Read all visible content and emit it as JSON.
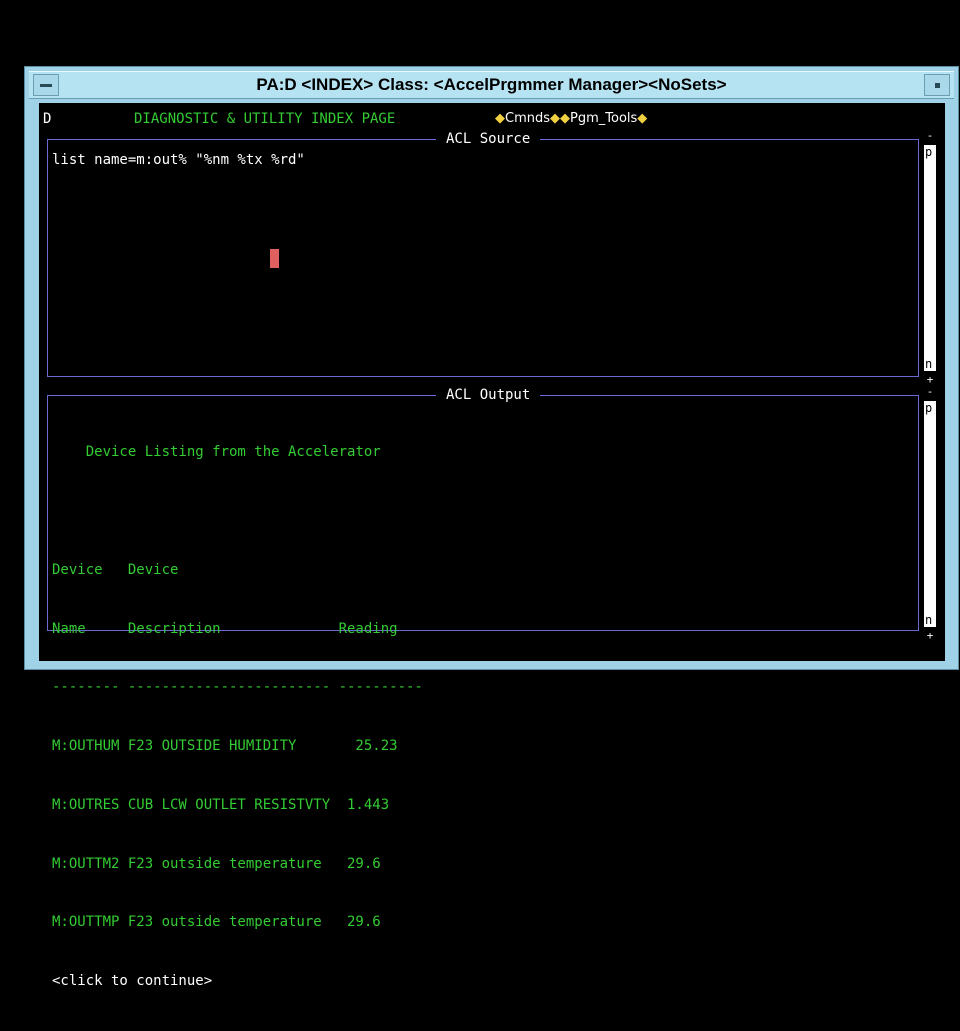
{
  "window": {
    "title": "PA:D <INDEX> Class: <AccelPrgmmer Manager><NoSets>"
  },
  "header": {
    "page_letter": "D",
    "page_heading": "DIAGNOSTIC & UTILITY INDEX PAGE",
    "menus": [
      {
        "label": "Cmnds"
      },
      {
        "label": "Pgm_Tools"
      }
    ]
  },
  "source_panel": {
    "label": "ACL Source",
    "text": "list name=m:out% \"%nm %tx %rd\""
  },
  "output_panel": {
    "label": "ACL Output",
    "title": "Device Listing from the Accelerator",
    "header_line1": "Device   Device",
    "header_line2": "Name     Description              Reading",
    "separator": "-------- ------------------------ ----------",
    "rows": [
      "M:OUTHUM F23 OUTSIDE HUMIDITY       25.23",
      "M:OUTRES CUB LCW OUTLET RESISTVTY  1.443",
      "M:OUTTM2 F23 outside temperature   29.6",
      "M:OUTTMP F23 outside temperature   29.6"
    ],
    "continue_prompt": "<click to continue>"
  },
  "scrollbar": {
    "top_glyph": "-",
    "bottom_glyph": "+",
    "page_up": "p",
    "page_down": "n"
  },
  "colors": {
    "window_frame": "#9fd2e6",
    "text_green": "#33cc33",
    "panel_border": "#6a6ad0",
    "cursor": "#e06060",
    "menu_diamond": "#f0d040"
  }
}
